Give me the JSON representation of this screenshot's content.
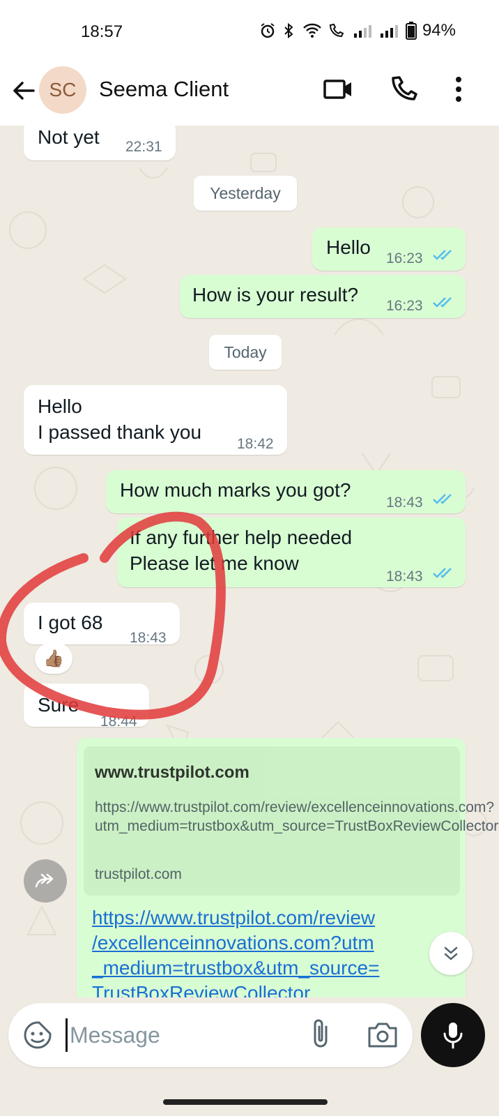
{
  "status_bar": {
    "time": "18:57",
    "battery": "94%"
  },
  "header": {
    "avatar_initials": "SC",
    "contact_name": "Seema Client"
  },
  "messages": [
    {
      "dir": "in",
      "text": "Not yet",
      "time": "22:31"
    },
    {
      "dir": "out",
      "text": "Hello",
      "time": "16:23"
    },
    {
      "dir": "out",
      "text": "How is your result?",
      "time": "16:23"
    },
    {
      "dir": "in",
      "text": "Hello\nI passed thank you",
      "time": "18:42"
    },
    {
      "dir": "out",
      "text": "How much marks you got?",
      "time": "18:43"
    },
    {
      "dir": "out",
      "text": "If any further help needed\nPlease let me know",
      "time": "18:43"
    },
    {
      "dir": "in",
      "text": "I got 68",
      "time": "18:43",
      "reaction": "👍🏽"
    },
    {
      "dir": "in",
      "text": "Sure",
      "time": "18:44"
    }
  ],
  "day_separators": {
    "yesterday": "Yesterday",
    "today": "Today"
  },
  "link_message": {
    "preview_domain": "www.trustpilot.com",
    "preview_url": "https://www.trustpilot.com/review/excellenceinnovations.com?utm_medium=trustbox&utm_source=TrustBoxReviewCollector",
    "preview_site": "trustpilot.com",
    "link_lines": [
      "https://www.trustpilot.com/review",
      "/excellenceinnovations.com?utm",
      "_medium=trustbox&utm_source=",
      "TrustBoxReviewCollector"
    ]
  },
  "input": {
    "placeholder": "Message"
  },
  "colors": {
    "outgoing_bubble": "#d9fdd3",
    "incoming_bubble": "#ffffff",
    "read_ticks": "#53bdeb",
    "annotation": "#e03a3a"
  }
}
